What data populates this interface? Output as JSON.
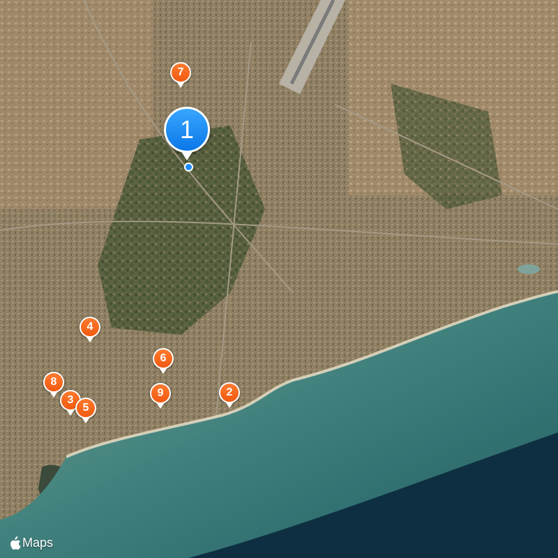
{
  "map": {
    "type": "satellite",
    "attribution": "Maps",
    "primary_pin": {
      "label": "1",
      "color": "#1a8cff"
    },
    "pins": [
      {
        "label": "2",
        "color": "#f2621a"
      },
      {
        "label": "3",
        "color": "#f2621a"
      },
      {
        "label": "4",
        "color": "#f2621a"
      },
      {
        "label": "5",
        "color": "#f2621a"
      },
      {
        "label": "6",
        "color": "#f2621a"
      },
      {
        "label": "7",
        "color": "#f2621a"
      },
      {
        "label": "8",
        "color": "#f2621a"
      },
      {
        "label": "9",
        "color": "#f2621a"
      }
    ]
  }
}
